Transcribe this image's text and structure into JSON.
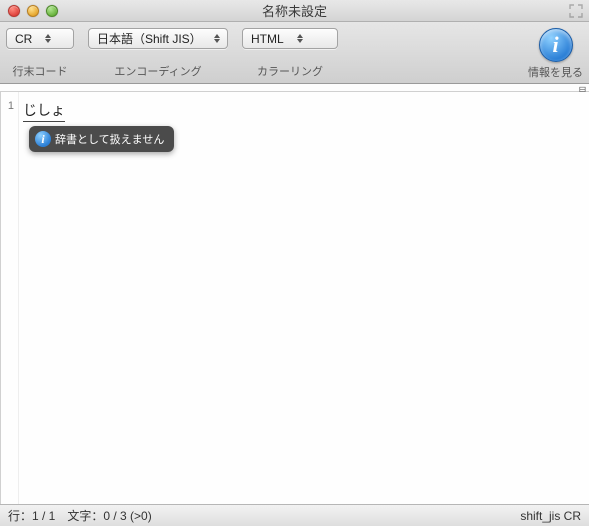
{
  "window": {
    "title": "名称未設定"
  },
  "toolbar": {
    "line_ending": {
      "value": "CR",
      "label": "行末コード"
    },
    "encoding": {
      "value": "日本語（Shift JIS）",
      "label": "エンコーディング"
    },
    "coloring": {
      "value": "HTML",
      "label": "カラーリング"
    },
    "info_label": "情報を見る"
  },
  "ruler": {
    "marker": "目"
  },
  "editor": {
    "line_number": "1",
    "text": "じしょ"
  },
  "tooltip": {
    "text": "辞書として扱えません"
  },
  "statusbar": {
    "left": "行：1 / 1　文字：0 / 3 (>0)",
    "right": "shift_jis CR"
  }
}
